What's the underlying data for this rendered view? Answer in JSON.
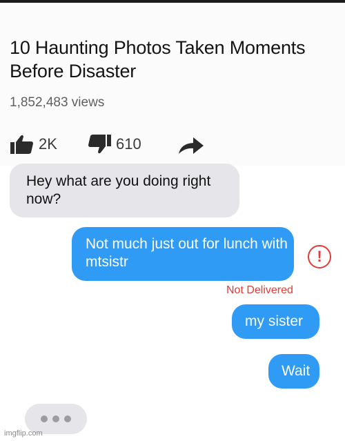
{
  "video": {
    "title": "10 Haunting Photos Taken Moments Before Disaster",
    "views": "1,852,483 views",
    "likes": "2K",
    "dislikes": "610"
  },
  "icons": {
    "like": "thumbs-up-icon",
    "dislike": "thumbs-down-icon",
    "share": "share-arrow-icon",
    "alert": "exclamation-circle-icon"
  },
  "messages": [
    {
      "direction": "received",
      "text": "Hey what are you doing right now?"
    },
    {
      "direction": "sent",
      "text": "Not much just out for lunch with mtsistr"
    },
    {
      "direction": "sent",
      "text": "my sister"
    },
    {
      "direction": "sent",
      "text": "Wait"
    }
  ],
  "status": {
    "not_delivered": "Not Delivered",
    "alert_symbol": "!"
  },
  "watermark": "imgflip.com",
  "colors": {
    "sent_bubble": "#2f9bf4",
    "received_bubble": "#e5e5ea",
    "error": "#e53935"
  }
}
